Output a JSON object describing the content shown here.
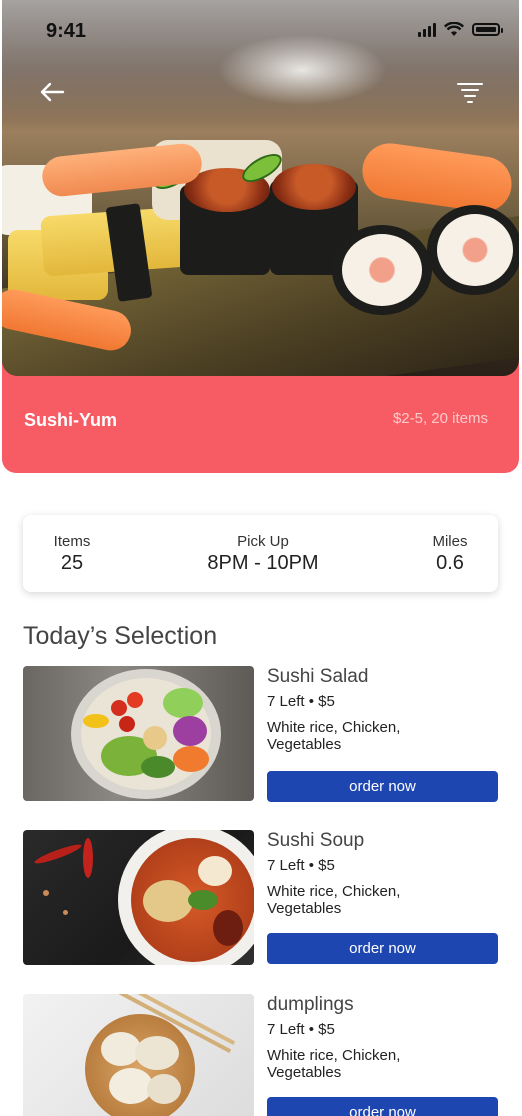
{
  "status_bar": {
    "time": "9:41"
  },
  "header": {
    "back_icon": "arrow-left-icon",
    "filter_icon": "filter-icon"
  },
  "restaurant": {
    "name": "Sushi-Yum",
    "meta": "$2-5, 20 items"
  },
  "info": {
    "items": {
      "label": "Items",
      "value": "25"
    },
    "pickup": {
      "label": "Pick Up",
      "value": "8PM - 10PM"
    },
    "miles": {
      "label": "Miles",
      "value": "0.6"
    }
  },
  "section_title": "Today’s Selection",
  "menu": [
    {
      "name": "Sushi Salad",
      "meta": "7 Left • $5",
      "desc": "White rice, Chicken, Vegetables",
      "button": "order now"
    },
    {
      "name": "Sushi Soup",
      "meta": "7 Left • $5",
      "desc": "White rice, Chicken, Vegetables",
      "button": "order now"
    },
    {
      "name": "dumplings",
      "meta": "7 Left • $5",
      "desc": "White rice, Chicken, Vegetables",
      "button": "order now"
    }
  ],
  "colors": {
    "accent_red": "#f75c64",
    "button_blue": "#1e46b0"
  }
}
